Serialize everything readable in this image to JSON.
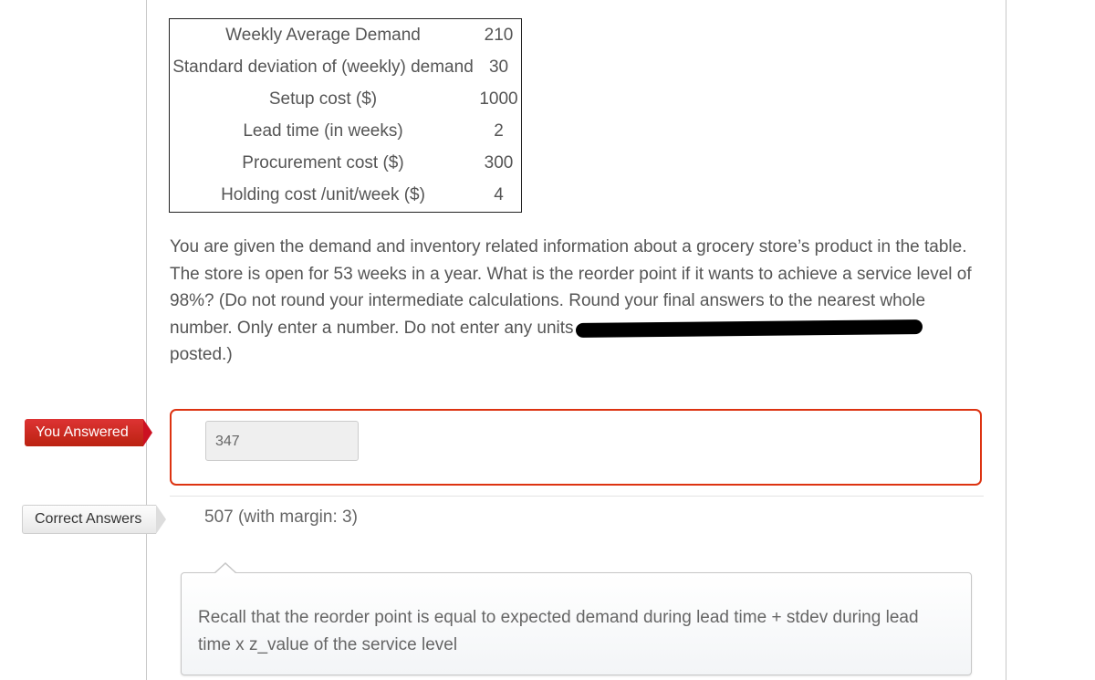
{
  "table": {
    "rows": [
      {
        "label": "Weekly Average Demand",
        "value": "210"
      },
      {
        "label": "Standard deviation of (weekly) demand",
        "value": "30"
      },
      {
        "label": "Setup cost ($)",
        "value": "1000"
      },
      {
        "label": "Lead time (in weeks)",
        "value": "2"
      },
      {
        "label": "Procurement cost ($)",
        "value": "300"
      },
      {
        "label": "Holding cost /unit/week ($)",
        "value": "4"
      }
    ]
  },
  "question": {
    "text_before_redaction": "You are given the demand and inventory related information about a grocery store’s product in the table. The store is open for 53 weeks in a year. What is the reorder point if it wants to achieve a service level of 98%? (Do not round your intermediate calculations. Round your final answers to the nearest whole number. Only enter a number. Do not enter any units",
    "text_after_redaction": "posted.)"
  },
  "you_answered": {
    "label": "You Answered",
    "value": "347",
    "status_color": "#d32f2f"
  },
  "correct_answers": {
    "label": "Correct Answers",
    "value": "507 (with margin: 3)"
  },
  "hint": {
    "text": "Recall that the reorder point is equal to expected demand during lead time + stdev during lead time x z_value of the service level"
  }
}
